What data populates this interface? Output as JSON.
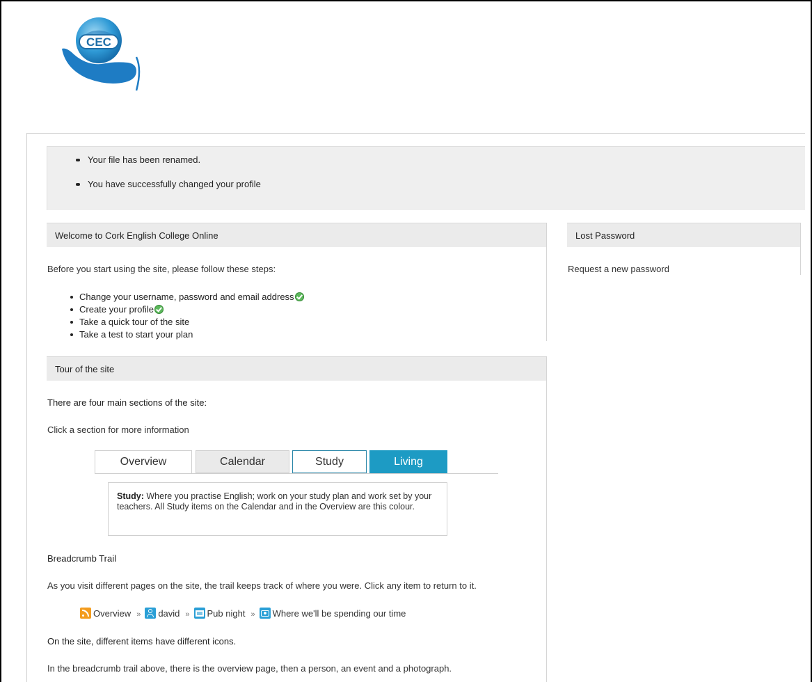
{
  "logo": {
    "text": "CEC"
  },
  "messages": [
    "Your file has been renamed.",
    "You have successfully changed your profile"
  ],
  "welcome": {
    "title": "Welcome to Cork English College Online",
    "intro": "Before you start using the site, please follow these steps:",
    "steps": [
      "Change your username, password and email address",
      "Create your profile",
      "Take a quick tour of the site",
      "Take a test to start your plan"
    ]
  },
  "lost_password": {
    "title": "Lost Password",
    "link": "Request a new password"
  },
  "tour": {
    "title": "Tour of the site",
    "sections_text": "There are four main sections of the site:",
    "click_text": "Click a section for more information",
    "tabs": [
      "Overview",
      "Calendar",
      "Study",
      "Living"
    ],
    "info_label": "Study:",
    "info_text": " Where you practise English; work on your study plan and work set by your teachers. All Study items on the Calendar and in the Overview are this colour.",
    "breadcrumb_heading": "Breadcrumb Trail",
    "breadcrumb_desc": "As you visit different pages on the site, the trail keeps track of where you were. Click any item to return to it.",
    "breadcrumb_items": [
      "Overview",
      "david",
      "Pub night",
      "Where we'll be spending our time"
    ],
    "breadcrumb_sep": "»",
    "icons_heading": "On the site, different items have different icons.",
    "icons_desc": "In the breadcrumb trail above, there is the overview page, then a person, an event and a photograph."
  },
  "colors": {
    "study": "#2a86a8",
    "living": "#1d9bc4",
    "check": "#5cb85c",
    "rss": "#f39c1e"
  }
}
